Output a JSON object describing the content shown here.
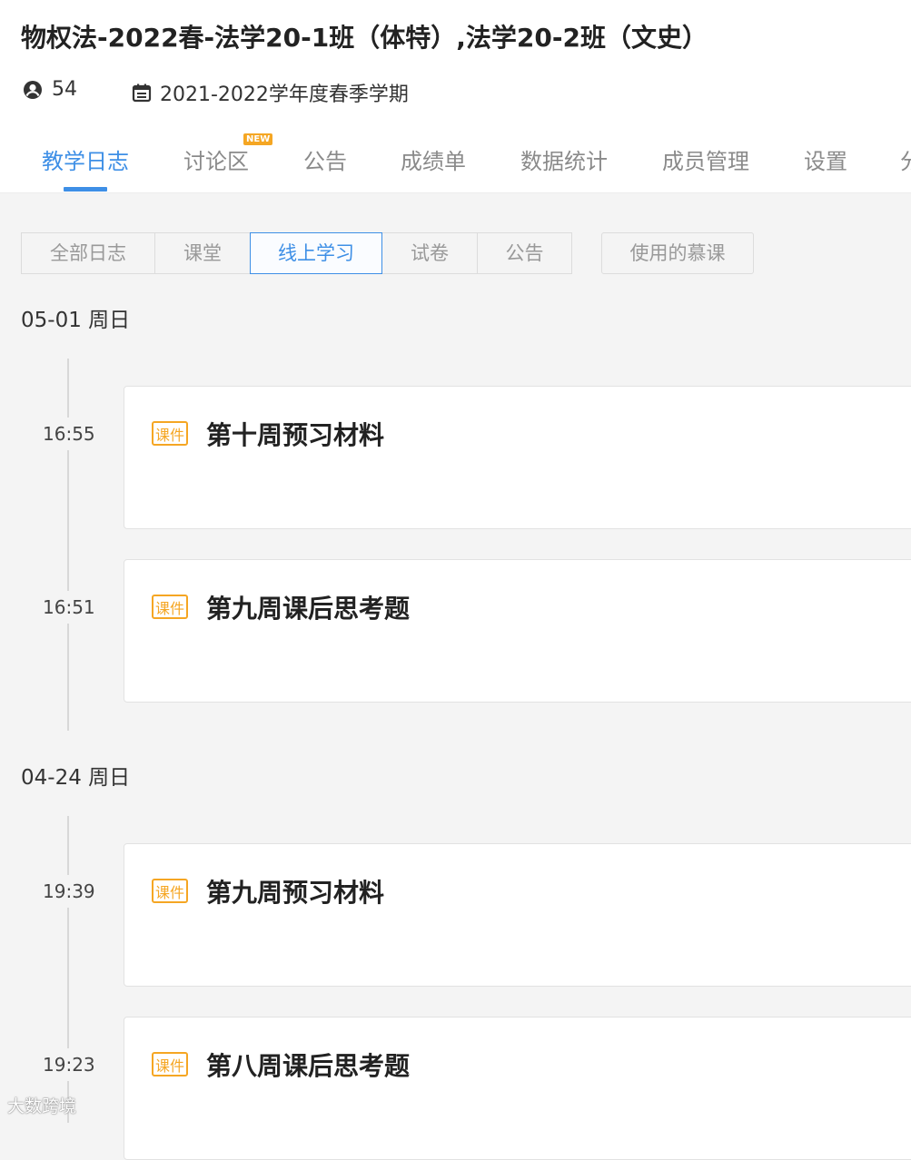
{
  "course": {
    "title": "物权法-2022春-法学20-1班（体特）,法学20-2班（文史）",
    "member_count": "54",
    "semester": "2021-2022学年度春季学期"
  },
  "tabs": [
    {
      "label": "教学日志",
      "active": true
    },
    {
      "label": "讨论区",
      "badge": "NEW"
    },
    {
      "label": "公告"
    },
    {
      "label": "成绩单"
    },
    {
      "label": "数据统计"
    },
    {
      "label": "成员管理"
    },
    {
      "label": "设置"
    },
    {
      "label": "分"
    }
  ],
  "filters": [
    {
      "label": "全部日志"
    },
    {
      "label": "课堂"
    },
    {
      "label": "线上学习",
      "active": true
    },
    {
      "label": "试卷"
    },
    {
      "label": "公告"
    }
  ],
  "mooc_button": "使用的慕课",
  "groups": [
    {
      "date": "05-01 周日",
      "entries": [
        {
          "time": "16:55",
          "tag": "课件",
          "title": "第十周预习材料"
        },
        {
          "time": "16:51",
          "tag": "课件",
          "title": "第九周课后思考题"
        }
      ]
    },
    {
      "date": "04-24 周日",
      "entries": [
        {
          "time": "19:39",
          "tag": "课件",
          "title": "第九周预习材料"
        },
        {
          "time": "19:23",
          "tag": "课件",
          "title": "第八周课后思考题"
        }
      ]
    }
  ],
  "watermark": "大数跨境",
  "colors": {
    "accent": "#3e8fe6",
    "tag": "#f5a623",
    "background": "#f4f4f4"
  }
}
